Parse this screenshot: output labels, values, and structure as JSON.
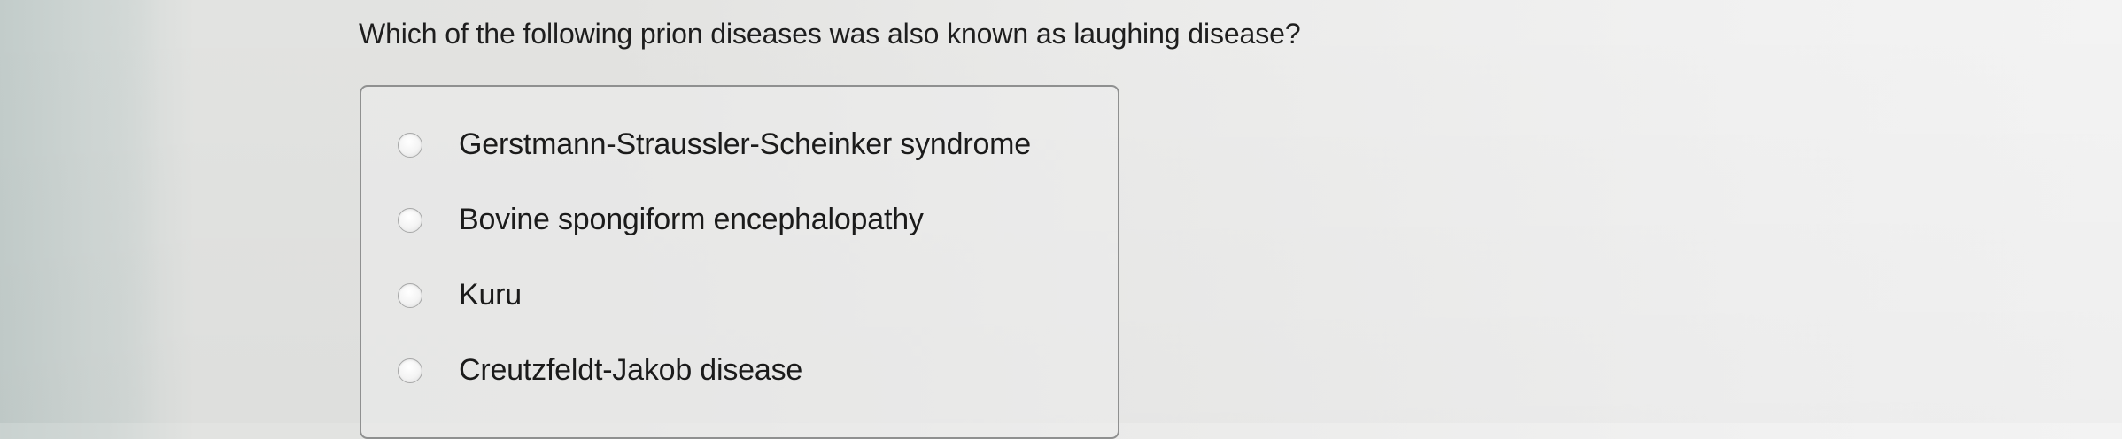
{
  "question": {
    "text": "Which of the following prion diseases was also known as laughing disease?"
  },
  "options": [
    {
      "label": "Gerstmann-Straussler-Scheinker syndrome",
      "selected": false
    },
    {
      "label": "Bovine spongiform encephalopathy",
      "selected": false
    },
    {
      "label": "Kuru",
      "selected": false
    },
    {
      "label": "Creutzfeldt-Jakob disease",
      "selected": false
    }
  ]
}
